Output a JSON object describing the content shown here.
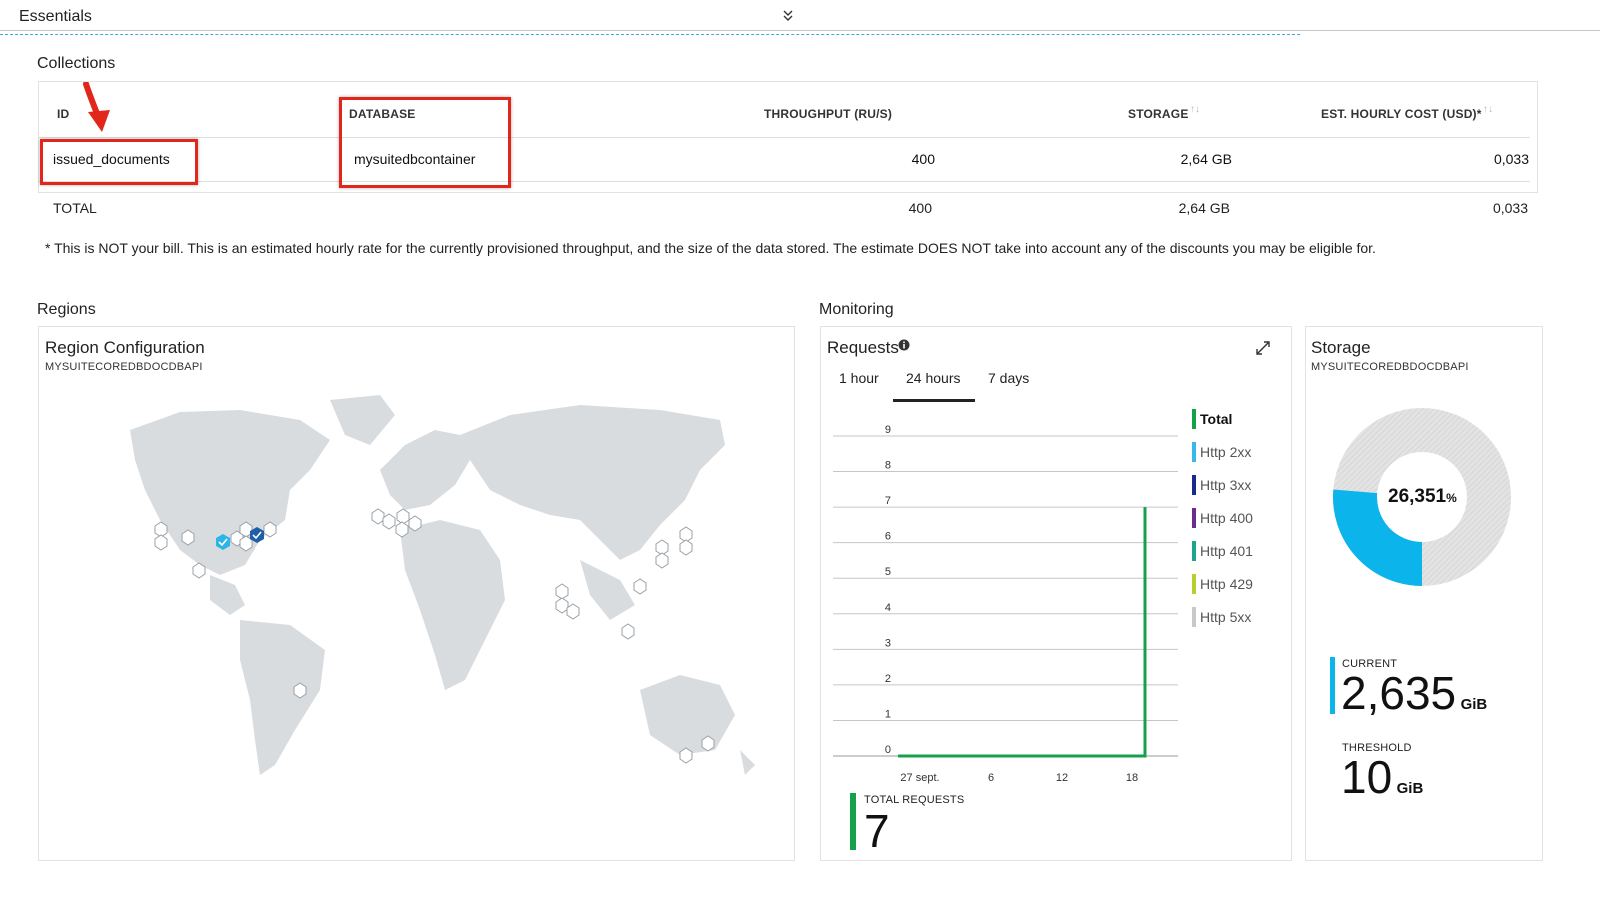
{
  "essentials": {
    "title": "Essentials"
  },
  "collections": {
    "title": "Collections",
    "columns": [
      "ID",
      "DATABASE",
      "THROUGHPUT (RU/S)",
      "STORAGE",
      "EST. HOURLY COST (USD)*"
    ],
    "row": {
      "id": "issued_documents",
      "database": "mysuitedbcontainer",
      "throughput": "400",
      "storage": "2,64 GB",
      "cost": "0,033"
    },
    "total": {
      "label": "TOTAL",
      "throughput": "400",
      "storage": "2,64 GB",
      "cost": "0,033"
    },
    "footnote": "* This is NOT your bill. This is an estimated hourly rate for the currently provisioned throughput, and the size of the data stored. The estimate DOES NOT take into account any of the discounts you may be eligible for.",
    "annotation_color": "#e2261c"
  },
  "regions": {
    "title": "Regions",
    "card_title": "Region Configuration",
    "card_subtitle": "MYSUITECOREDBDOCDBAPI"
  },
  "monitoring": {
    "title": "Monitoring",
    "requests": {
      "title": "Requests",
      "tabs": [
        "1 hour",
        "24 hours",
        "7 days"
      ],
      "active_tab": "24 hours",
      "legend": [
        {
          "label": "Total",
          "color": "#15a04a"
        },
        {
          "label": "Http 2xx",
          "color": "#3ab8ea"
        },
        {
          "label": "Http 3xx",
          "color": "#1a2a8c"
        },
        {
          "label": "Http 400",
          "color": "#6b2d8c"
        },
        {
          "label": "Http 401",
          "color": "#1aa58c"
        },
        {
          "label": "Http 429",
          "color": "#b9cf2c"
        },
        {
          "label": "Http 5xx",
          "color": "#c8c8c8"
        }
      ],
      "total_label": "TOTAL REQUESTS",
      "total_value": "7"
    }
  },
  "storage": {
    "title": "Storage",
    "subtitle": "MYSUITECOREDBDOCDBAPI",
    "percent": "26,351",
    "percent_unit": "%",
    "current_label": "CURRENT",
    "current_value": "2,635",
    "current_unit": "GiB",
    "threshold_label": "THRESHOLD",
    "threshold_value": "10",
    "threshold_unit": "GiB",
    "used_color": "#0bb4ea"
  },
  "chart_data": {
    "type": "line",
    "x_tick_labels": [
      "27 sept.",
      "6",
      "12",
      "18"
    ],
    "y_ticks": [
      0,
      1,
      2,
      3,
      4,
      5,
      6,
      7,
      8,
      9
    ],
    "ylim": [
      0,
      9
    ],
    "series": [
      {
        "name": "Total",
        "points": [
          {
            "x": "27 sept.",
            "y": 0
          },
          {
            "x": "18",
            "y": 0
          },
          {
            "x": "18",
            "y": 7
          },
          {
            "x": "18",
            "y": 0
          }
        ]
      }
    ],
    "grid": true,
    "legend_position": "right"
  }
}
